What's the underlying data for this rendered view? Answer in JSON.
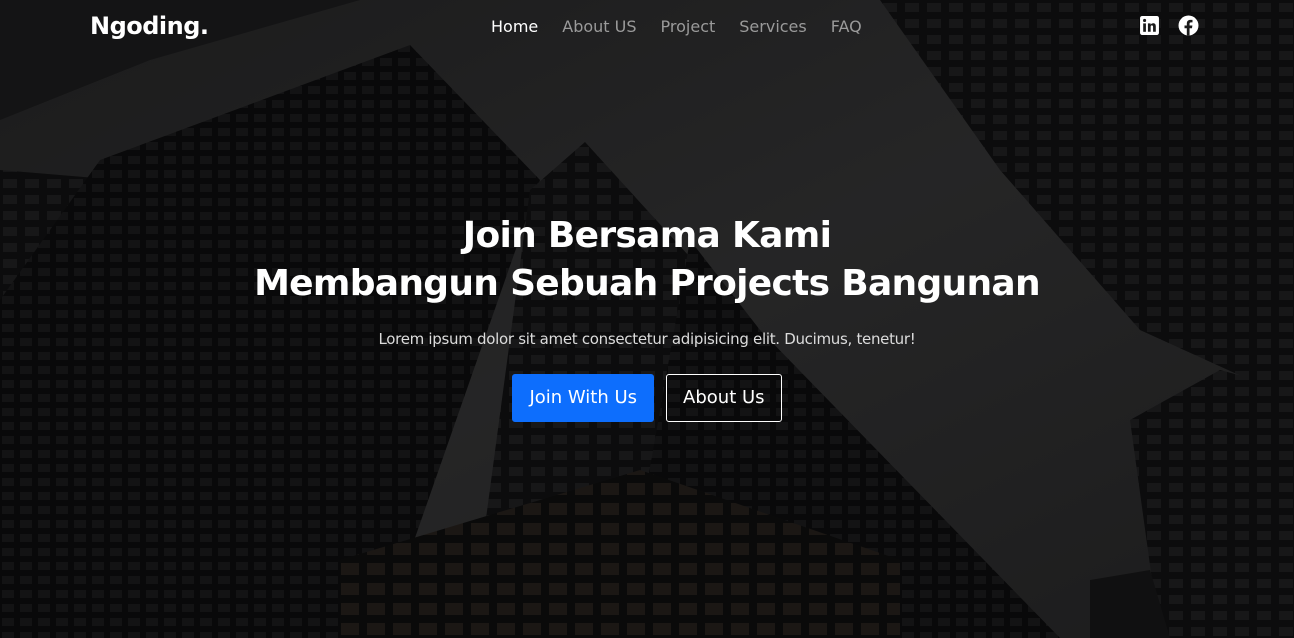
{
  "brand": "Ngoding.",
  "nav": {
    "items": [
      {
        "label": "Home",
        "active": true
      },
      {
        "label": "About US",
        "active": false
      },
      {
        "label": "Project",
        "active": false
      },
      {
        "label": "Services",
        "active": false
      },
      {
        "label": "FAQ",
        "active": false
      }
    ]
  },
  "social": {
    "icons": [
      "linkedin-icon",
      "facebook-icon"
    ]
  },
  "hero": {
    "title_line1": "Join Bersama Kami",
    "title_line2": "Membangun Sebuah Projects Bangunan",
    "subtitle": "Lorem ipsum dolor sit amet consectetur adipisicing elit. Ducimus, tenetur!",
    "primary_button": "Join With Us",
    "secondary_button": "About Us"
  },
  "colors": {
    "accent": "#0d6efd",
    "overlay": "#000000",
    "text": "#ffffff",
    "nav_muted": "#9a9a9a"
  }
}
